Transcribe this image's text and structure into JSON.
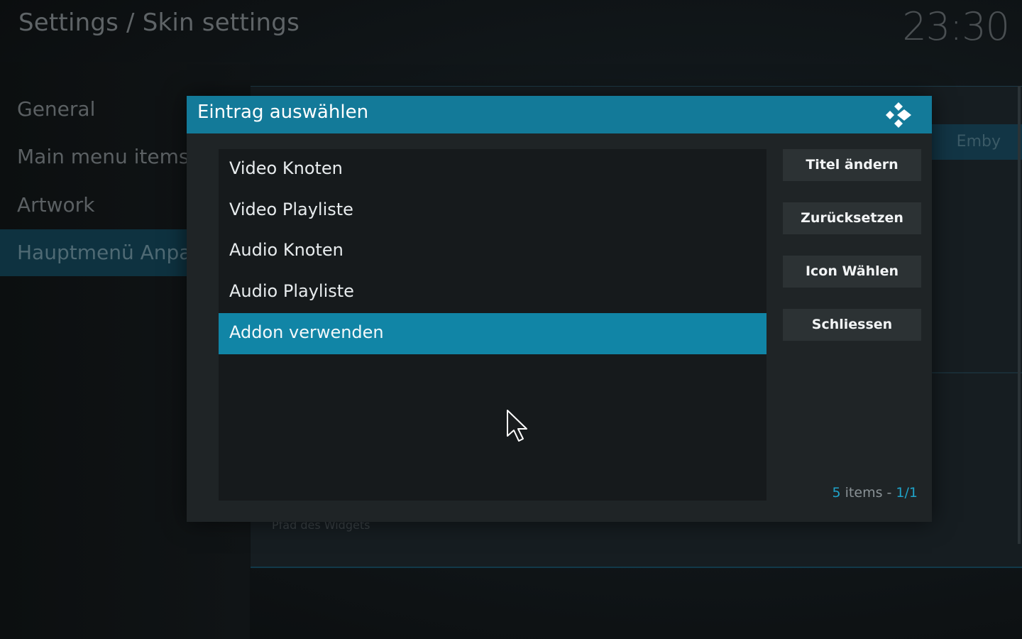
{
  "header": {
    "title": "Settings / Skin settings",
    "clock": "23:30"
  },
  "sidebar": {
    "items": [
      {
        "label": "General"
      },
      {
        "label": "Main menu items"
      },
      {
        "label": "Artwork"
      },
      {
        "label": "Hauptmenü Anpass",
        "active": true
      }
    ]
  },
  "background": {
    "emby_label": "Emby",
    "widget_path_label": "Pfad des Widgets"
  },
  "dialog": {
    "title": "Eintrag auswählen",
    "logo_icon": "kodi-logo-icon",
    "list": [
      {
        "label": "Video Knoten"
      },
      {
        "label": "Video Playliste"
      },
      {
        "label": "Audio Knoten"
      },
      {
        "label": "Audio Playliste"
      },
      {
        "label": "Addon verwenden",
        "selected": true
      }
    ],
    "buttons": {
      "change_title": "Titel ändern",
      "reset": "Zurücksetzen",
      "choose_icon": "Icon Wählen",
      "close": "Schliessen"
    },
    "count": {
      "number": "5",
      "items_text": " items - ",
      "page": "1/1"
    }
  },
  "colors": {
    "accent": "#137a99",
    "selected": "#1185a6",
    "page_highlight": "#1fa3c9"
  }
}
